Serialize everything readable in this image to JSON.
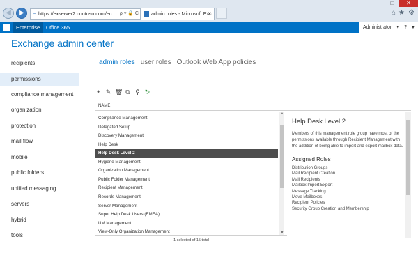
{
  "browser": {
    "address": "https://exserver2.contoso.com/ec",
    "address_tools": "ρ ▾ 🔒 C",
    "tab_title": "admin roles - Microsoft Exc...",
    "tab_close": "×",
    "window_controls": {
      "minimize": "−",
      "maximize": "□",
      "close": "✕"
    },
    "icons": {
      "back": "back-arrow-icon",
      "forward": "forward-arrow-icon",
      "home": "home-icon",
      "favorites": "star-icon",
      "settings": "gear-icon"
    }
  },
  "suite_bar": {
    "enterprise": "Enterprise",
    "office": "Office 365",
    "user": "Administrator",
    "help": "?",
    "colors": {
      "bar": "#0072c6",
      "active": "#005a9e"
    }
  },
  "app_title": "Exchange admin center",
  "left_nav": {
    "items": [
      "recipients",
      "permissions",
      "compliance management",
      "organization",
      "protection",
      "mail flow",
      "mobile",
      "public folders",
      "unified messaging",
      "servers",
      "hybrid",
      "tools"
    ],
    "selected": "permissions"
  },
  "tabs": [
    {
      "label": "admin roles",
      "active": true
    },
    {
      "label": "user roles",
      "active": false
    },
    {
      "label": "Outlook Web App policies",
      "active": false
    }
  ],
  "toolbar": [
    "add-icon",
    "edit-icon",
    "delete-icon",
    "copy-icon",
    "search-icon",
    "refresh-icon"
  ],
  "list": {
    "column_header": "NAME",
    "rows": [
      "Compliance Management",
      "Delegated Setup",
      "Discovery Management",
      "Help Desk",
      "Help Desk Level 2",
      "Hygiene Management",
      "Organization Management",
      "Public Folder Management",
      "Recipient Management",
      "Records Management",
      "Server Management",
      "Super Help Desk Users (EMEA)",
      "UM Management",
      "View-Only Organization Management"
    ],
    "selected_index": 4,
    "status": "1 selected of 15 total"
  },
  "detail": {
    "title": "Help Desk Level 2",
    "description": "Members of this management role group have most of the permissions available through Recipient Management with the addition of being able to import and export mailbox data.",
    "assigned_roles_heading": "Assigned Roles",
    "assigned_roles": [
      "Distribution Groups",
      "Mail Recipient Creation",
      "Mail Recipients",
      "Mailbox Import Export",
      "Message Tracking",
      "Move Mailboxes",
      "Recipient Policies",
      "Security Group Creation and Membership"
    ]
  }
}
